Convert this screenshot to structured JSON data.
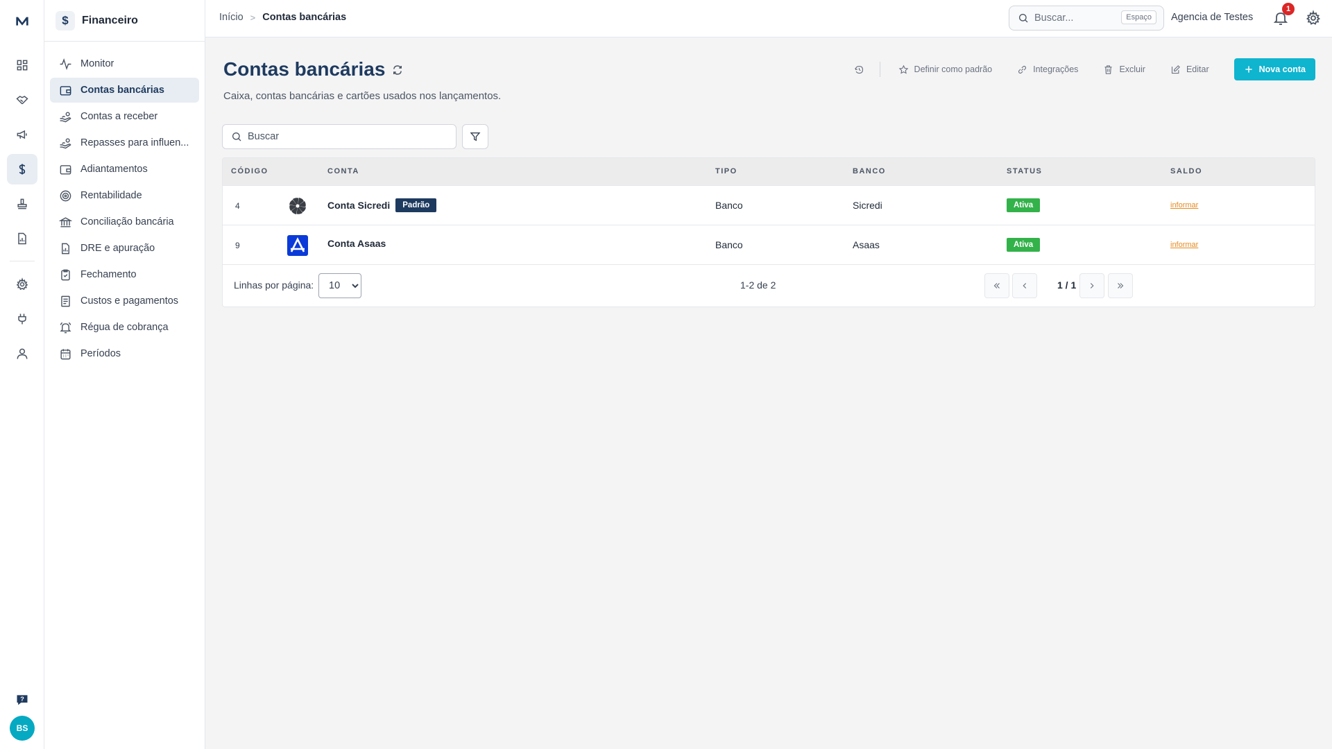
{
  "brand": {
    "logo_letter": "M"
  },
  "rail": {
    "avatar_initials": "BS"
  },
  "sidebar": {
    "module_title": "Financeiro",
    "module_symbol": "$",
    "items": [
      {
        "label": "Monitor",
        "icon": "activity-icon"
      },
      {
        "label": "Contas bancárias",
        "icon": "wallet-icon",
        "active": true
      },
      {
        "label": "Contas a receber",
        "icon": "hand-coins-icon"
      },
      {
        "label": "Repasses para influen...",
        "icon": "hand-coins-icon"
      },
      {
        "label": "Adiantamentos",
        "icon": "wallet-icon"
      },
      {
        "label": "Rentabilidade",
        "icon": "target-icon"
      },
      {
        "label": "Conciliação bancária",
        "icon": "bank-icon"
      },
      {
        "label": "DRE e apuração",
        "icon": "file-chart-icon"
      },
      {
        "label": "Fechamento",
        "icon": "clipboard-check-icon"
      },
      {
        "label": "Custos e pagamentos",
        "icon": "receipt-icon"
      },
      {
        "label": "Régua de cobrança",
        "icon": "bell-ring-icon"
      },
      {
        "label": "Períodos",
        "icon": "calendar-icon"
      }
    ]
  },
  "topbar": {
    "breadcrumb_home": "Início",
    "breadcrumb_separator": ">",
    "breadcrumb_current": "Contas bancárias",
    "search_placeholder": "Buscar...",
    "search_shortcut": "Espaço",
    "org_name": "Agencia de Testes",
    "notification_count": "1"
  },
  "page": {
    "title": "Contas bancárias",
    "subtitle": "Caixa, contas bancárias e cartões usados nos lançamentos."
  },
  "actions": {
    "set_default": "Definir como padrão",
    "integrations": "Integrações",
    "delete": "Excluir",
    "edit": "Editar",
    "new_account": "Nova conta"
  },
  "list": {
    "search_placeholder": "Buscar",
    "columns": {
      "code": "CÓDIGO",
      "account": "CONTA",
      "type": "TIPO",
      "bank": "BANCO",
      "status": "STATUS",
      "balance": "SALDO"
    },
    "rows": [
      {
        "code": "4",
        "name": "Conta Sicredi",
        "default_badge": "Padrão",
        "type": "Banco",
        "bank": "Sicredi",
        "status": "Ativa",
        "balance_link": "informar",
        "logo": "sicredi-logo"
      },
      {
        "code": "9",
        "name": "Conta Asaas",
        "type": "Banco",
        "bank": "Asaas",
        "status": "Ativa",
        "balance_link": "informar",
        "logo": "asaas-logo"
      }
    ],
    "footer": {
      "rows_per_page_label": "Linhas por página:",
      "rows_per_page_value": "10",
      "range": "1-2 de 2",
      "page_indicator": "1 / 1"
    }
  },
  "colors": {
    "primary": "#0fb4cf",
    "title": "#1e3a5f",
    "active_badge": "#33b24a",
    "link": "#e58a1f",
    "notification": "#dc2626"
  }
}
